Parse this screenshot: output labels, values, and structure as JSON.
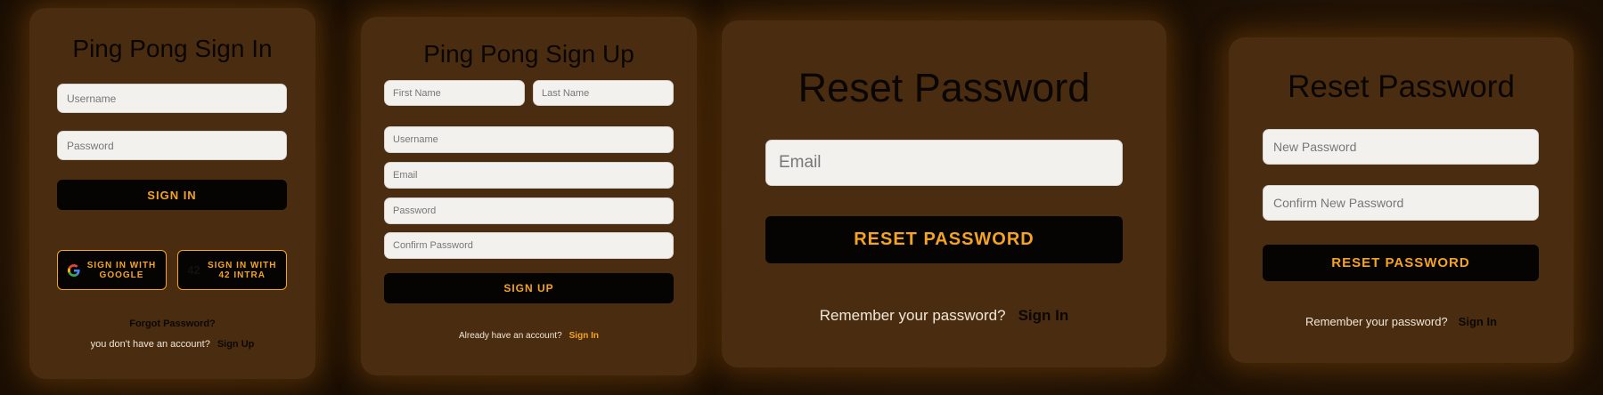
{
  "signin": {
    "title": "Ping Pong Sign In",
    "username_placeholder": "Username",
    "password_placeholder": "Password",
    "submit_label": "SIGN IN",
    "google_label": "SIGN IN WITH GOOGLE",
    "intra_label": "SIGN IN WITH 42 INTRA",
    "forgot_label": "Forgot Password?",
    "no_account_text": "you don't have an account?",
    "signup_link": "Sign Up"
  },
  "signup": {
    "title": "Ping Pong Sign Up",
    "first_name_placeholder": "First Name",
    "last_name_placeholder": "Last Name",
    "username_placeholder": "Username",
    "email_placeholder": "Email",
    "password_placeholder": "Password",
    "confirm_placeholder": "Confirm Password",
    "submit_label": "SIGN UP",
    "have_account_text": "Already have an account?",
    "signin_link": "Sign In"
  },
  "reset_request": {
    "title": "Reset Password",
    "email_placeholder": "Email",
    "submit_label": "RESET PASSWORD",
    "remember_text": "Remember your password?",
    "signin_link": "Sign In"
  },
  "reset_confirm": {
    "title": "Reset Password",
    "new_password_placeholder": "New Password",
    "confirm_password_placeholder": "Confirm New Password",
    "submit_label": "RESET PASSWORD",
    "remember_text": "Remember your password?",
    "signin_link": "Sign In"
  },
  "colors": {
    "accent": "#f5a320",
    "card": "#4a2d11",
    "background": "#1d1003",
    "button": "#050403"
  },
  "icons": {
    "google": "google-icon",
    "intra": "intra-42-icon"
  }
}
